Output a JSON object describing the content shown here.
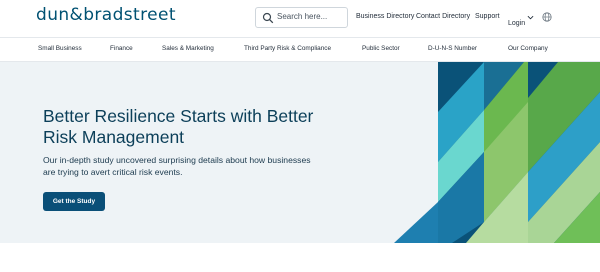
{
  "brand": {
    "logo_text": "dun&bradstreet",
    "primary_color": "#005172"
  },
  "search": {
    "placeholder": "Search here...",
    "icon": "search-icon"
  },
  "topnav": {
    "items": [
      "Business Directory",
      "Contact Directory",
      "Support"
    ],
    "login_label": "Login",
    "login_icon": "chevron-down-icon",
    "language_icon": "globe-icon"
  },
  "mainnav": {
    "items": [
      "Small Business",
      "Finance",
      "Sales & Marketing",
      "Third Party Risk & Compliance",
      "Public Sector",
      "D-U-N-S Number",
      "Our Company"
    ]
  },
  "hero": {
    "title": "Better Resilience Starts with Better Risk Management",
    "description": "Our in-depth study uncovered surprising details about how businesses are trying to avert critical risk events.",
    "cta_label": "Get the Study",
    "background_color": "#eef3f6",
    "cta_color": "#0a4f78"
  }
}
